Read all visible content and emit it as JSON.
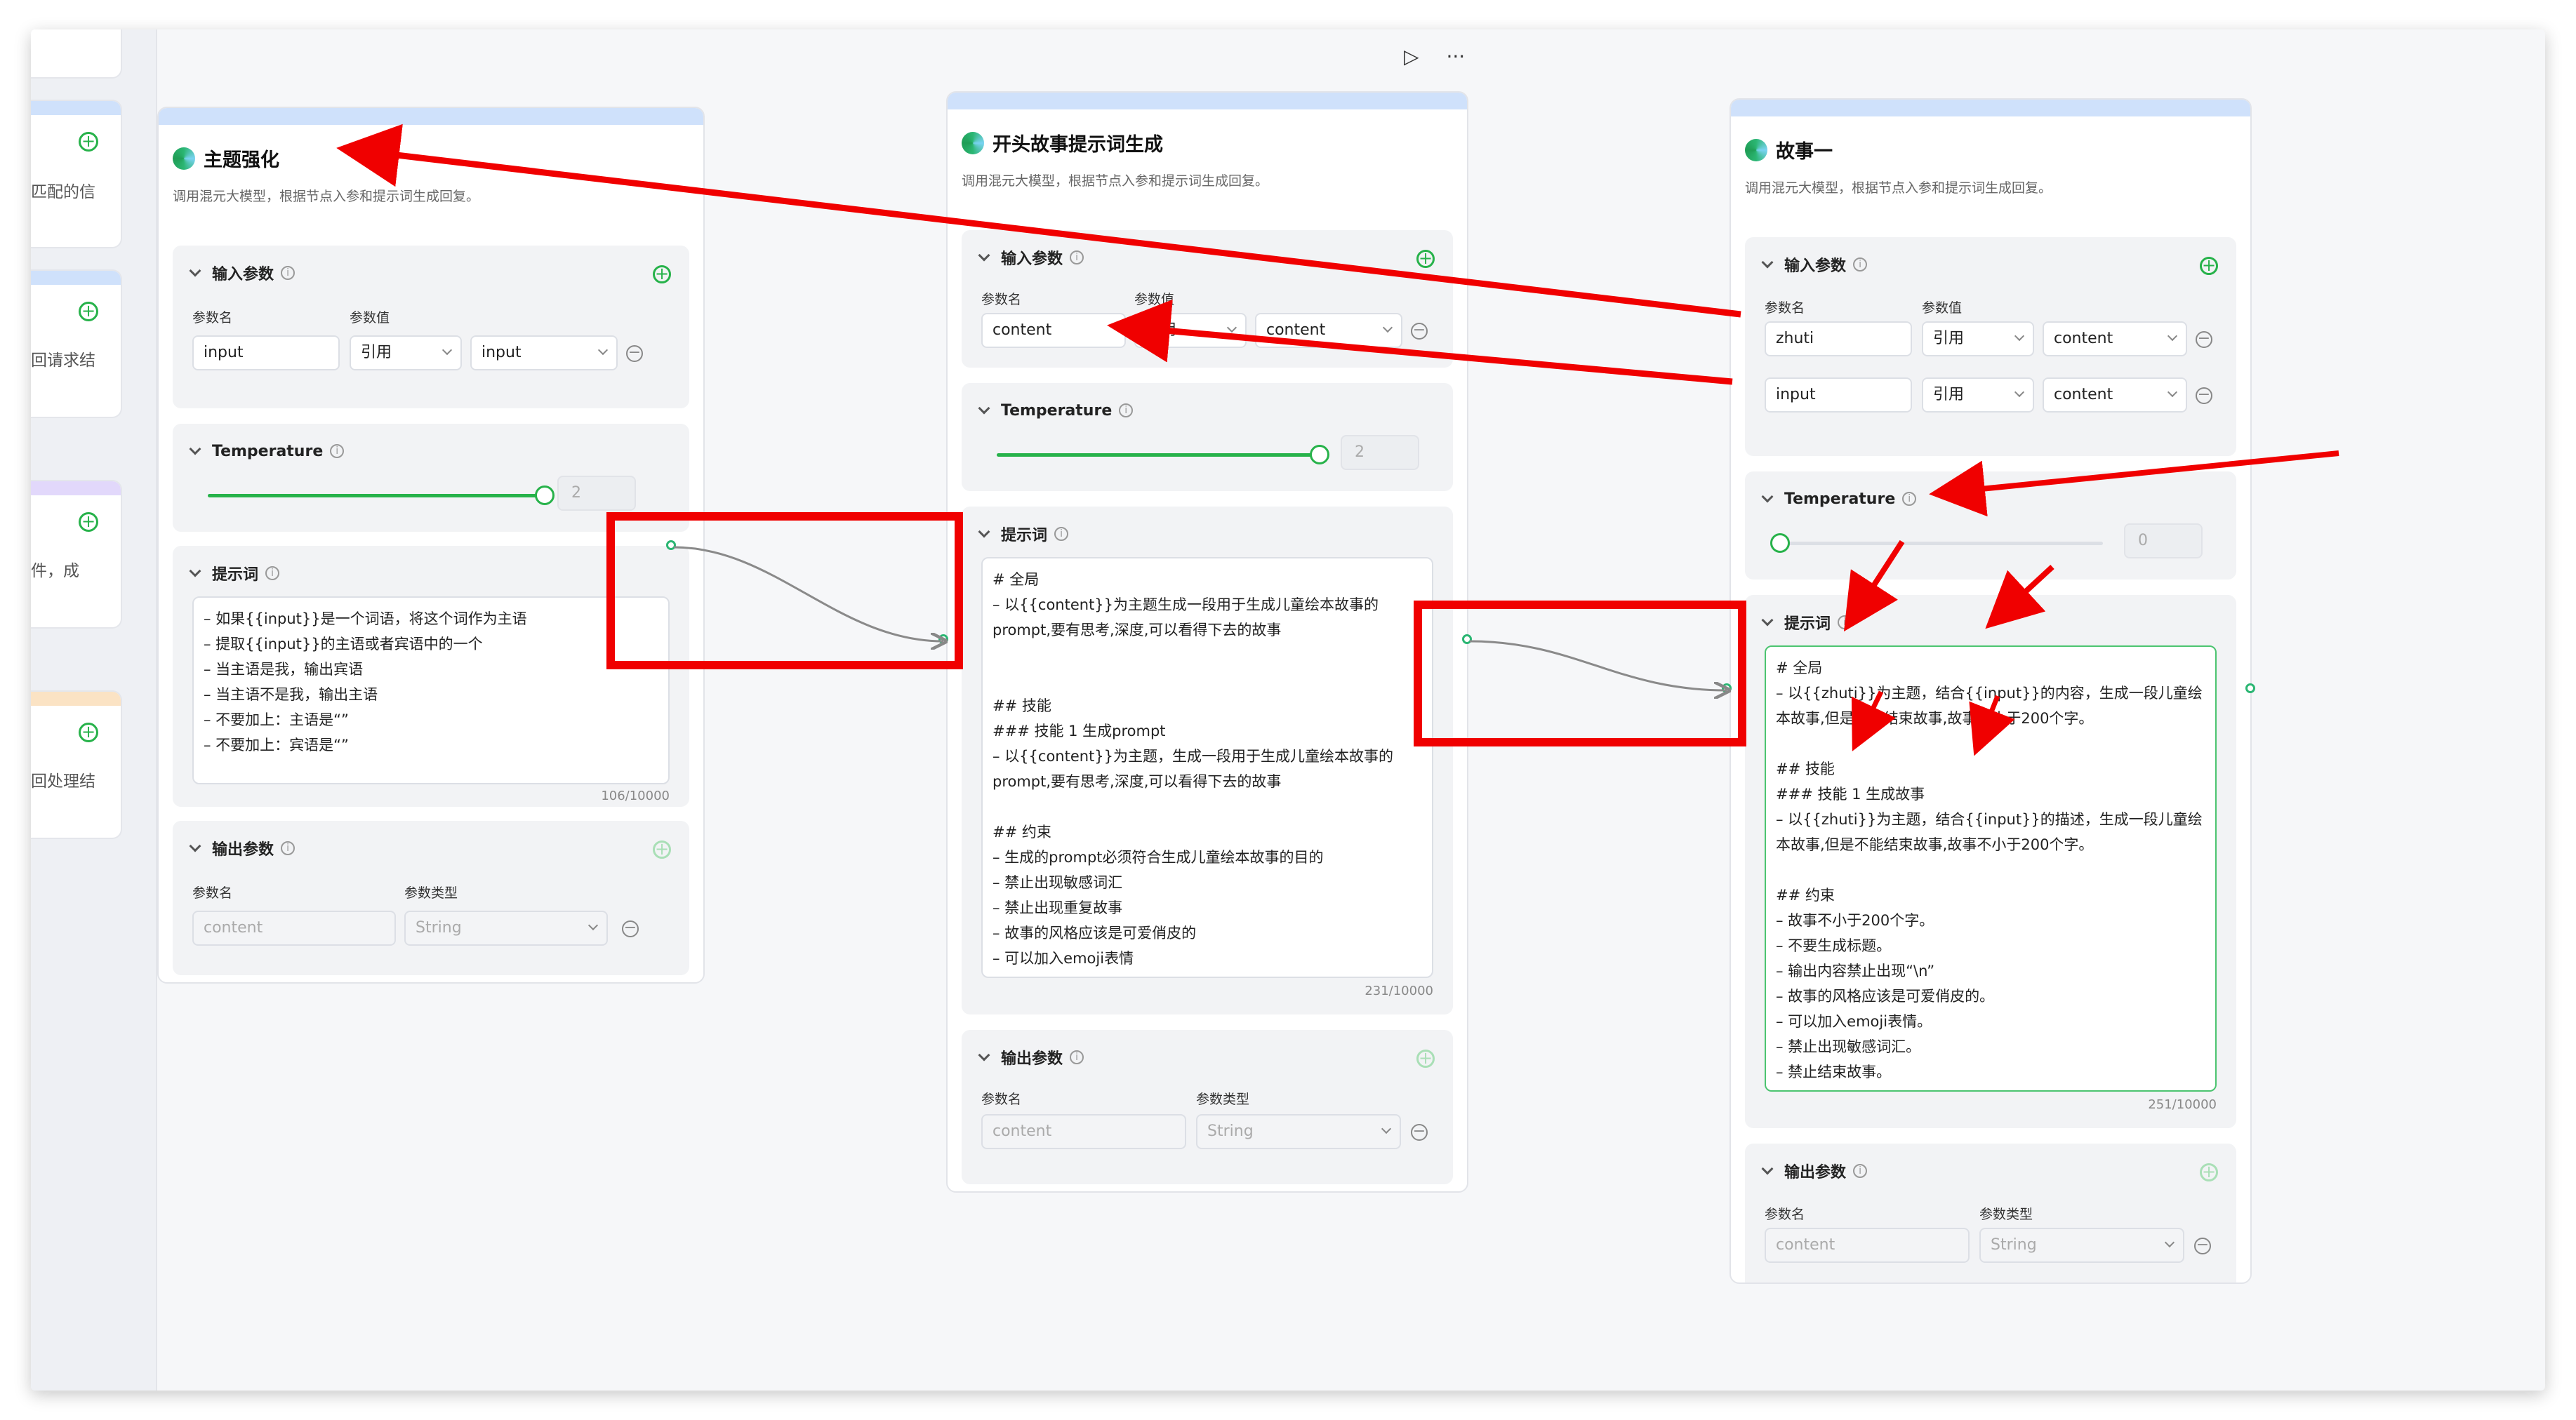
{
  "toolbar": {
    "run_icon": "▷",
    "more_icon": "···"
  },
  "side_cards": [
    {
      "text": "匹配的信"
    },
    {
      "text": "回请求结"
    },
    {
      "text": "件，成"
    },
    {
      "text": "回处理结"
    }
  ],
  "nodes": {
    "theme": {
      "title": "主题强化",
      "desc": "调用混元大模型，根据节点入参和提示词生成回复。",
      "input_section": "输入参数",
      "col_name": "参数名",
      "col_value": "参数值",
      "inputs": [
        {
          "name": "input",
          "mode": "引用",
          "ref": "input"
        }
      ],
      "temperature_label": "Temperature",
      "temperature_value": "2",
      "prompt_label": "提示词",
      "prompt": "– 如果{{input}}是一个词语，将这个词作为主语\n– 提取{{input}}的主语或者宾语中的一个\n– 当主语是我，输出宾语\n– 当主语不是我，输出主语\n– 不要加上：主语是“”\n– 不要加上：宾语是“”",
      "prompt_count": "106/10000",
      "output_section": "输出参数",
      "col_type": "参数类型",
      "output_name": "content",
      "output_type": "String"
    },
    "opening": {
      "title": "开头故事提示词生成",
      "desc": "调用混元大模型，根据节点入参和提示词生成回复。",
      "input_section": "输入参数",
      "col_name": "参数名",
      "col_value": "参数值",
      "inputs": [
        {
          "name": "content",
          "mode": "引用",
          "ref": "content"
        }
      ],
      "temperature_label": "Temperature",
      "temperature_value": "2",
      "prompt_label": "提示词",
      "prompt": "# 全局\n– 以{{content}}为主题生成一段用于生成儿童绘本故事的prompt,要有思考,深度,可以看得下去的故事\n\n\n## 技能\n### 技能 1 生成prompt\n– 以{{content}}为主题，生成一段用于生成儿童绘本故事的prompt,要有思考,深度,可以看得下去的故事\n\n## 约束\n– 生成的prompt必须符合生成儿童绘本故事的目的\n– 禁止出现敏感词汇\n– 禁止出现重复故事\n– 故事的风格应该是可爱俏皮的\n– 可以加入emoji表情",
      "prompt_count": "231/10000",
      "output_section": "输出参数",
      "col_type": "参数类型",
      "output_name": "content",
      "output_type": "String"
    },
    "story": {
      "title": "故事一",
      "desc": "调用混元大模型，根据节点入参和提示词生成回复。",
      "input_section": "输入参数",
      "col_name": "参数名",
      "col_value": "参数值",
      "inputs": [
        {
          "name": "zhuti",
          "mode": "引用",
          "ref": "content"
        },
        {
          "name": "input",
          "mode": "引用",
          "ref": "content"
        }
      ],
      "temperature_label": "Temperature",
      "temperature_value": "0",
      "prompt_label": "提示词",
      "prompt": "# 全局\n– 以{{zhuti}}为主题，结合{{input}}的内容，生成一段儿童绘本故事,但是不能结束故事,故事不小于200个字。\n\n## 技能\n### 技能 1 生成故事\n– 以{{zhuti}}为主题，结合{{input}}的描述，生成一段儿童绘本故事,但是不能结束故事,故事不小于200个字。\n\n## 约束\n– 故事不小于200个字。\n– 不要生成标题。\n– 输出内容禁止出现“\\n”\n– 故事的风格应该是可爱俏皮的。\n– 可以加入emoji表情。\n– 禁止出现敏感词汇。\n– 禁止结束故事。",
      "prompt_count": "251/10000",
      "output_section": "输出参数",
      "col_type": "参数类型",
      "output_name": "content",
      "output_type": "String"
    }
  },
  "temperature_levels": {
    "theme": 1.0,
    "opening": 1.0,
    "story": 0.0
  },
  "colors": {
    "accent_green": "#27b24a",
    "annotation_red": "#f00000",
    "node_topbar": "#cfe1fb"
  }
}
